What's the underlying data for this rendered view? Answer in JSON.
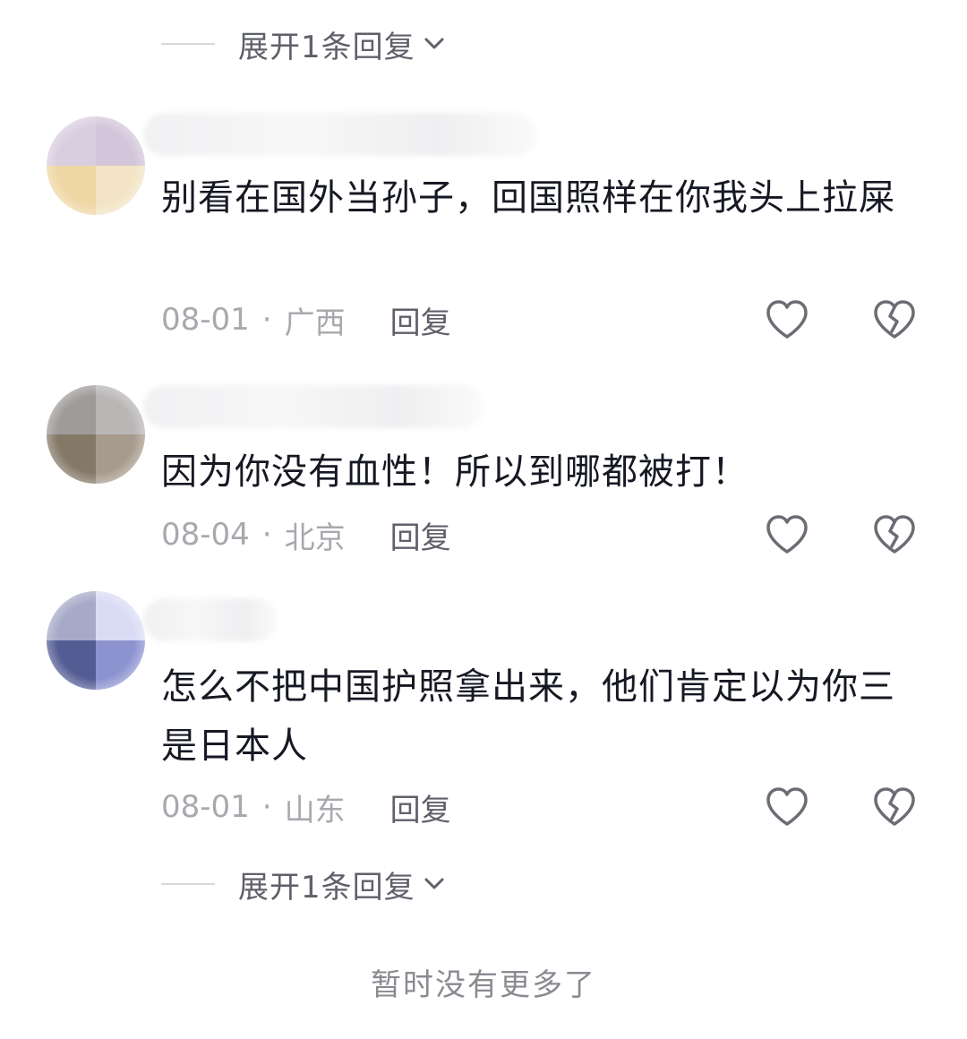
{
  "expand_top": {
    "label": "展开1条回复"
  },
  "comments": [
    {
      "text": "别看在国外当孙子，回国照样在你我头上拉屎",
      "date": "08-01",
      "location": "广西",
      "reply_label": "回复",
      "avatar_colors": [
        "#d9cde0",
        "#d3c6db",
        "#efd7a5",
        "#f2e4c4"
      ]
    },
    {
      "text": "因为你没有血性！所以到哪都被打！",
      "date": "08-04",
      "location": "北京",
      "reply_label": "回复",
      "avatar_colors": [
        "#9e9b99",
        "#b9b7b6",
        "#847867",
        "#a79b8d"
      ]
    },
    {
      "text": "怎么不把中国护照拿出来，他们肯定以为你三是日本人",
      "date": "08-01",
      "location": "山东",
      "reply_label": "回复",
      "avatar_colors": [
        "#a6aac8",
        "#dadcf5",
        "#545c94",
        "#8c93cf"
      ]
    }
  ],
  "expand_bottom": {
    "label": "展开1条回复"
  },
  "footer": {
    "no_more": "暂时没有更多了"
  },
  "icons": {
    "like": "heart-outline-icon",
    "dislike": "broken-heart-icon"
  },
  "colors": {
    "primary_text": "#161823",
    "secondary_text": "#a8a9ae",
    "reply_text": "#5f616a"
  }
}
